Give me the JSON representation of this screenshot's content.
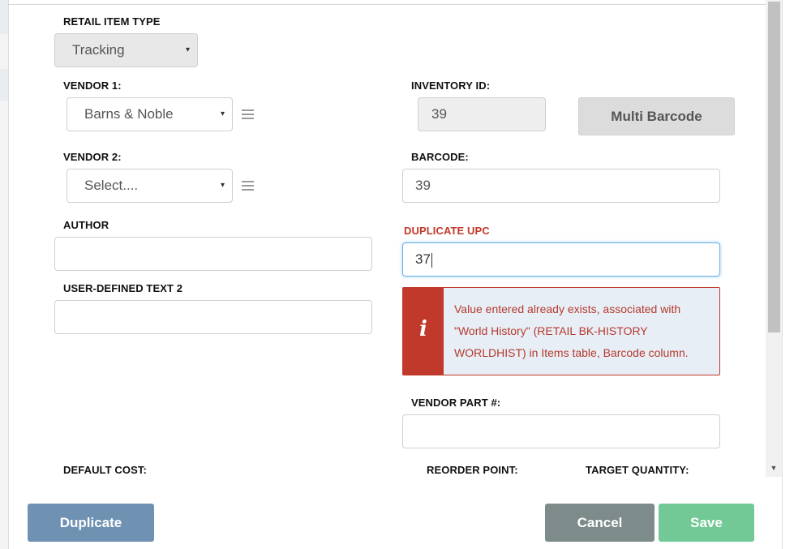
{
  "form": {
    "retail_item_type": {
      "label": "RETAIL ITEM TYPE",
      "value": "Tracking"
    },
    "vendor1": {
      "label": "VENDOR 1:",
      "value": "Barns & Noble"
    },
    "vendor2": {
      "label": "VENDOR 2:",
      "value": "Select...."
    },
    "author": {
      "label": "AUTHOR",
      "value": ""
    },
    "user_defined_text_2": {
      "label": "USER-DEFINED TEXT 2",
      "value": ""
    },
    "inventory_id": {
      "label": "INVENTORY ID:",
      "value": "39"
    },
    "multi_barcode_label": "Multi Barcode",
    "barcode": {
      "label": "BARCODE:",
      "value": "39"
    },
    "duplicate_upc": {
      "label": "DUPLICATE UPC",
      "value": "37"
    },
    "error_message": "Value entered already exists, associated with \"World History\" (RETAIL BK-HISTORY WORLDHIST) in Items table, Barcode column.",
    "vendor_part": {
      "label": "VENDOR PART #:",
      "value": ""
    },
    "default_cost": {
      "label": "DEFAULT COST:"
    },
    "reorder_point": {
      "label": "REORDER POINT:"
    },
    "target_quantity": {
      "label": "TARGET QUANTITY:"
    }
  },
  "footer": {
    "duplicate_label": "Duplicate",
    "cancel_label": "Cancel",
    "save_label": "Save"
  },
  "icons": {
    "caret": "▾",
    "info": "i",
    "scroll_down": "▼"
  },
  "colors": {
    "error": "#c0392b",
    "duplicate_button": "#6f92b3",
    "cancel_button": "#7e8b8b",
    "save_button": "#72c996",
    "focus_border": "#66afe9"
  }
}
